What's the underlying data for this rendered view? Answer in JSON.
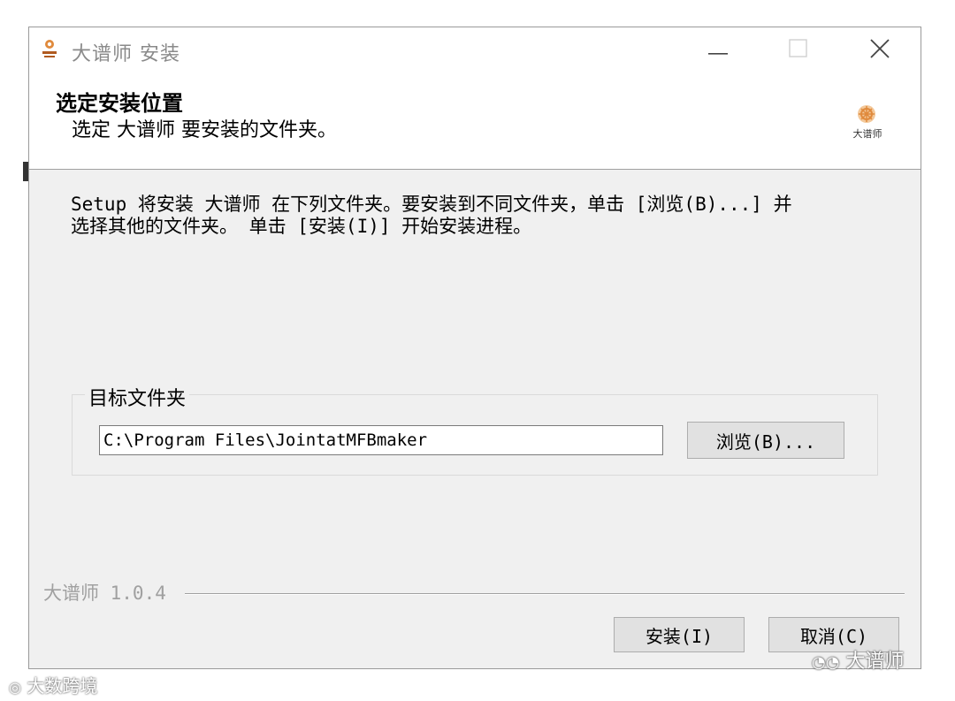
{
  "window": {
    "title": "大谱师 安装",
    "controls": {
      "minimize_icon": "minimize-icon",
      "maximize_icon": "maximize-icon",
      "close_icon": "close-icon"
    }
  },
  "header": {
    "title": "选定安装位置",
    "subtitle": "选定 大谱师 要安装的文件夹。",
    "logo_text": "大谱师"
  },
  "body": {
    "line1": "Setup 将安装 大谱师 在下列文件夹。要安装到不同文件夹，单击 [浏览(B)...] 并",
    "line2": "选择其他的文件夹。 单击 [安装(I)] 开始安装进程。"
  },
  "destination": {
    "group_label": "目标文件夹",
    "path_value": "C:\\Program Files\\JointatMFBmaker",
    "browse_label": "浏览(B)..."
  },
  "footer": {
    "brand": "大谱师 1.0.4",
    "install_label": "安装(I)",
    "cancel_label": "取消(C)"
  },
  "watermarks": {
    "right": "大谱师",
    "left": "大数跨境"
  },
  "colors": {
    "dialog_bg": "#f0f0f0",
    "header_bg": "#ffffff",
    "logo_accent": "#e08a3c"
  }
}
